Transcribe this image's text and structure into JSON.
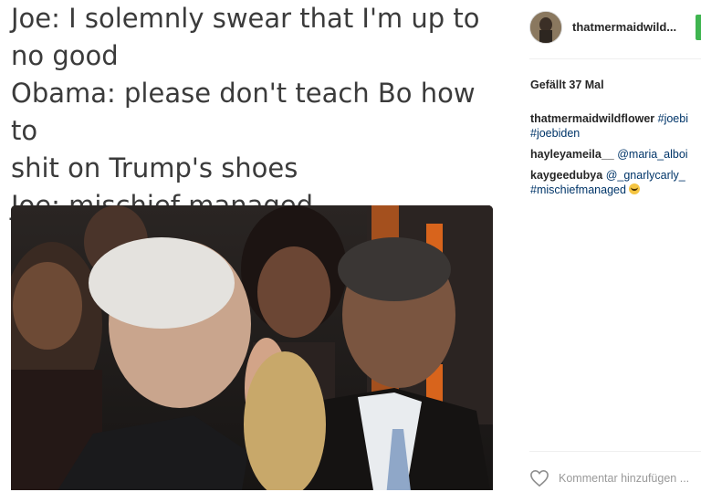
{
  "caption": {
    "lines": [
      "Joe: I solemnly swear that I'm up to",
      "no good",
      "Obama: please don't teach Bo how to",
      "shit on Trump's shoes",
      "Joe: mischief managed"
    ]
  },
  "header": {
    "username": "thatmermaidwild..."
  },
  "likes": "Gefällt 37 Mal",
  "comments": [
    {
      "user": "thatmermaidwildflower",
      "text": "#joebi",
      "text2": "#joebiden"
    },
    {
      "user": "hayleyameila__",
      "text": "@maria_alboi"
    },
    {
      "user": "kaygeedubya",
      "text": "@_gnarlycarly_",
      "text2": "#mischiefmanaged"
    }
  ],
  "footer": {
    "placeholder": "Kommentar hinzufügen ..."
  },
  "icons": {
    "like": "heart-icon",
    "emoji": "grinning-face-icon"
  }
}
